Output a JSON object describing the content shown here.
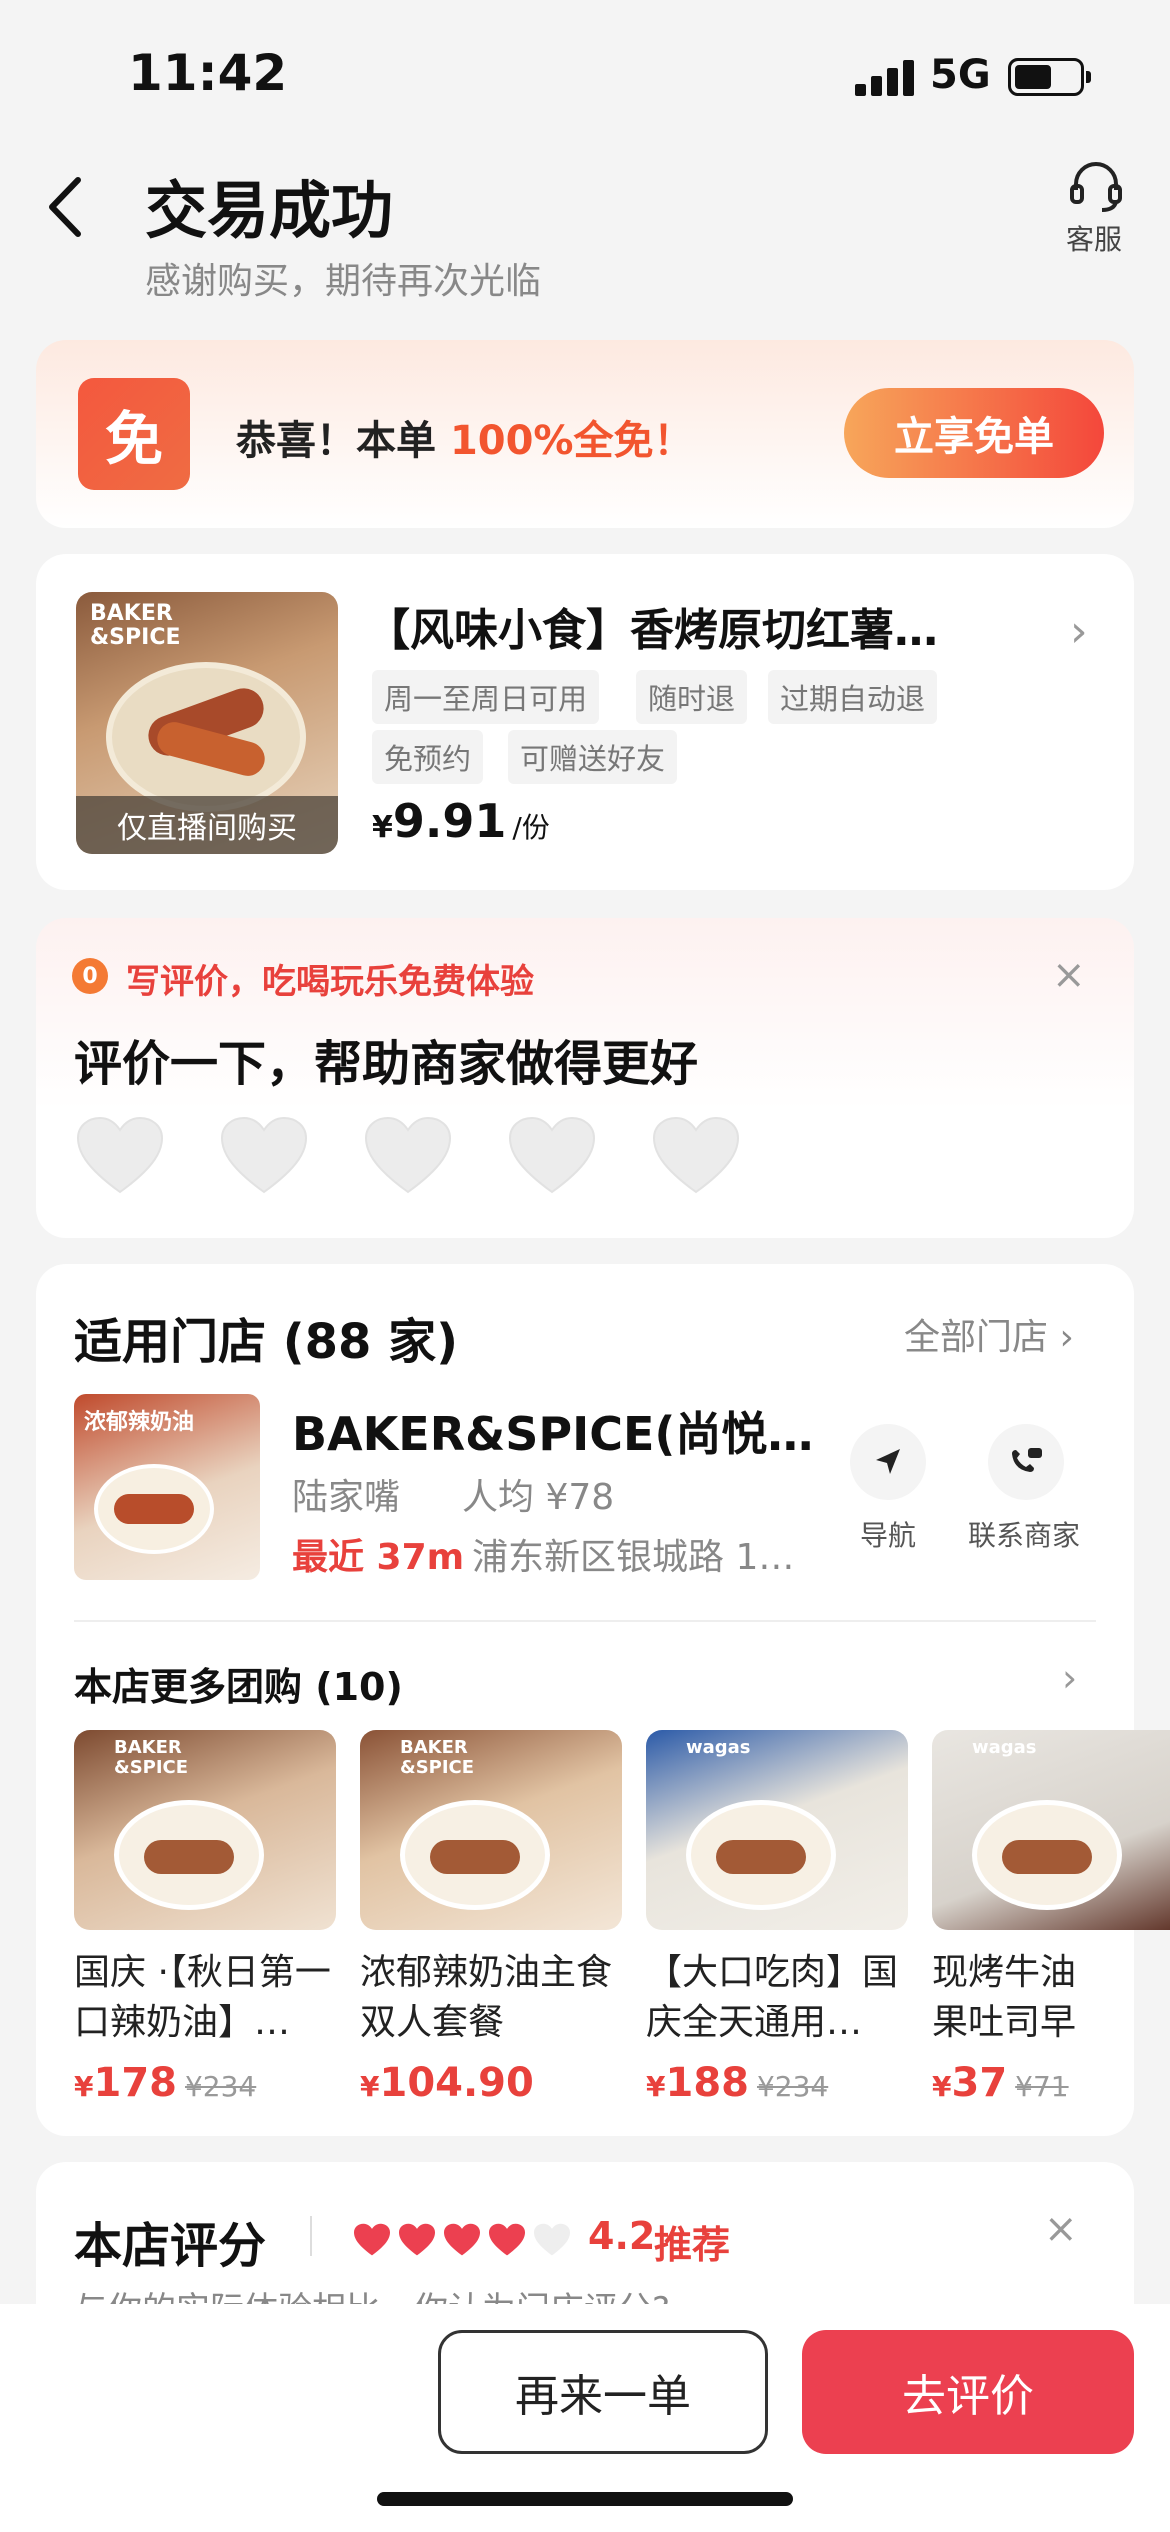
{
  "status_bar": {
    "time": "11:42",
    "network": "5G"
  },
  "header": {
    "title": "交易成功",
    "subtitle": "感谢购买，期待再次光临",
    "service_label": "客服"
  },
  "promo": {
    "badge": "免",
    "text_prefix": "恭喜！本单 ",
    "text_highlight": "100%全免！",
    "button": "立享免单"
  },
  "product": {
    "image_brand_line1": "BAKER",
    "image_brand_line2": "&SPICE",
    "image_overlay": "仅直播间购买",
    "title": "【风味小食】香烤原切红薯…",
    "tags": [
      "周一至周日可用",
      "随时退",
      "过期自动退",
      "免预约",
      "可赠送好友"
    ],
    "price_currency": "¥",
    "price": "9.91",
    "unit": "/份"
  },
  "review_prompt": {
    "coin": "0",
    "promo": "写评价，吃喝玩乐免费体验",
    "title": "评价一下，帮助商家做得更好",
    "close": "×",
    "hearts": 5
  },
  "store": {
    "title": "适用门店 (88 家)",
    "all_stores": "全部门店 ›",
    "image_label": "浓郁辣奶油",
    "name": "BAKER&SPICE(尚悦…",
    "area": "陆家嘴",
    "avg_price": "人均 ¥78",
    "distance": "最近 37m",
    "address": "浦东新区银城路 1…",
    "nav_label": "导航",
    "contact_label": "联系商家",
    "more_title": "本店更多团购 (10)",
    "deals": [
      {
        "title": "国庆 ·【秋日第一口辣奶油】…",
        "price": "178",
        "old_price": "¥234"
      },
      {
        "title": "浓郁辣奶油主食双人套餐",
        "price": "104.90",
        "old_price": ""
      },
      {
        "title": "【大口吃肉】国庆全天通用…",
        "price": "188",
        "old_price": "¥234"
      },
      {
        "title": "现烤牛油果吐司早餐套餐",
        "price": "37",
        "old_price": "¥71"
      }
    ],
    "deal_brands": [
      "BAKER &SPICE",
      "BAKER &SPICE",
      "wagas",
      "wagas"
    ]
  },
  "rating": {
    "title": "本店评分",
    "score": "4.2",
    "recommend": "推荐",
    "filled_hearts": 4,
    "subtitle": "与你的实际体验相比，你认为门店评分?",
    "close": "×"
  },
  "bottom_bar": {
    "again": "再来一单",
    "review": "去评价"
  },
  "colors": {
    "accent_red": "#ec4050",
    "promo_orange": "#f2552f",
    "text_gray": "#888888"
  }
}
